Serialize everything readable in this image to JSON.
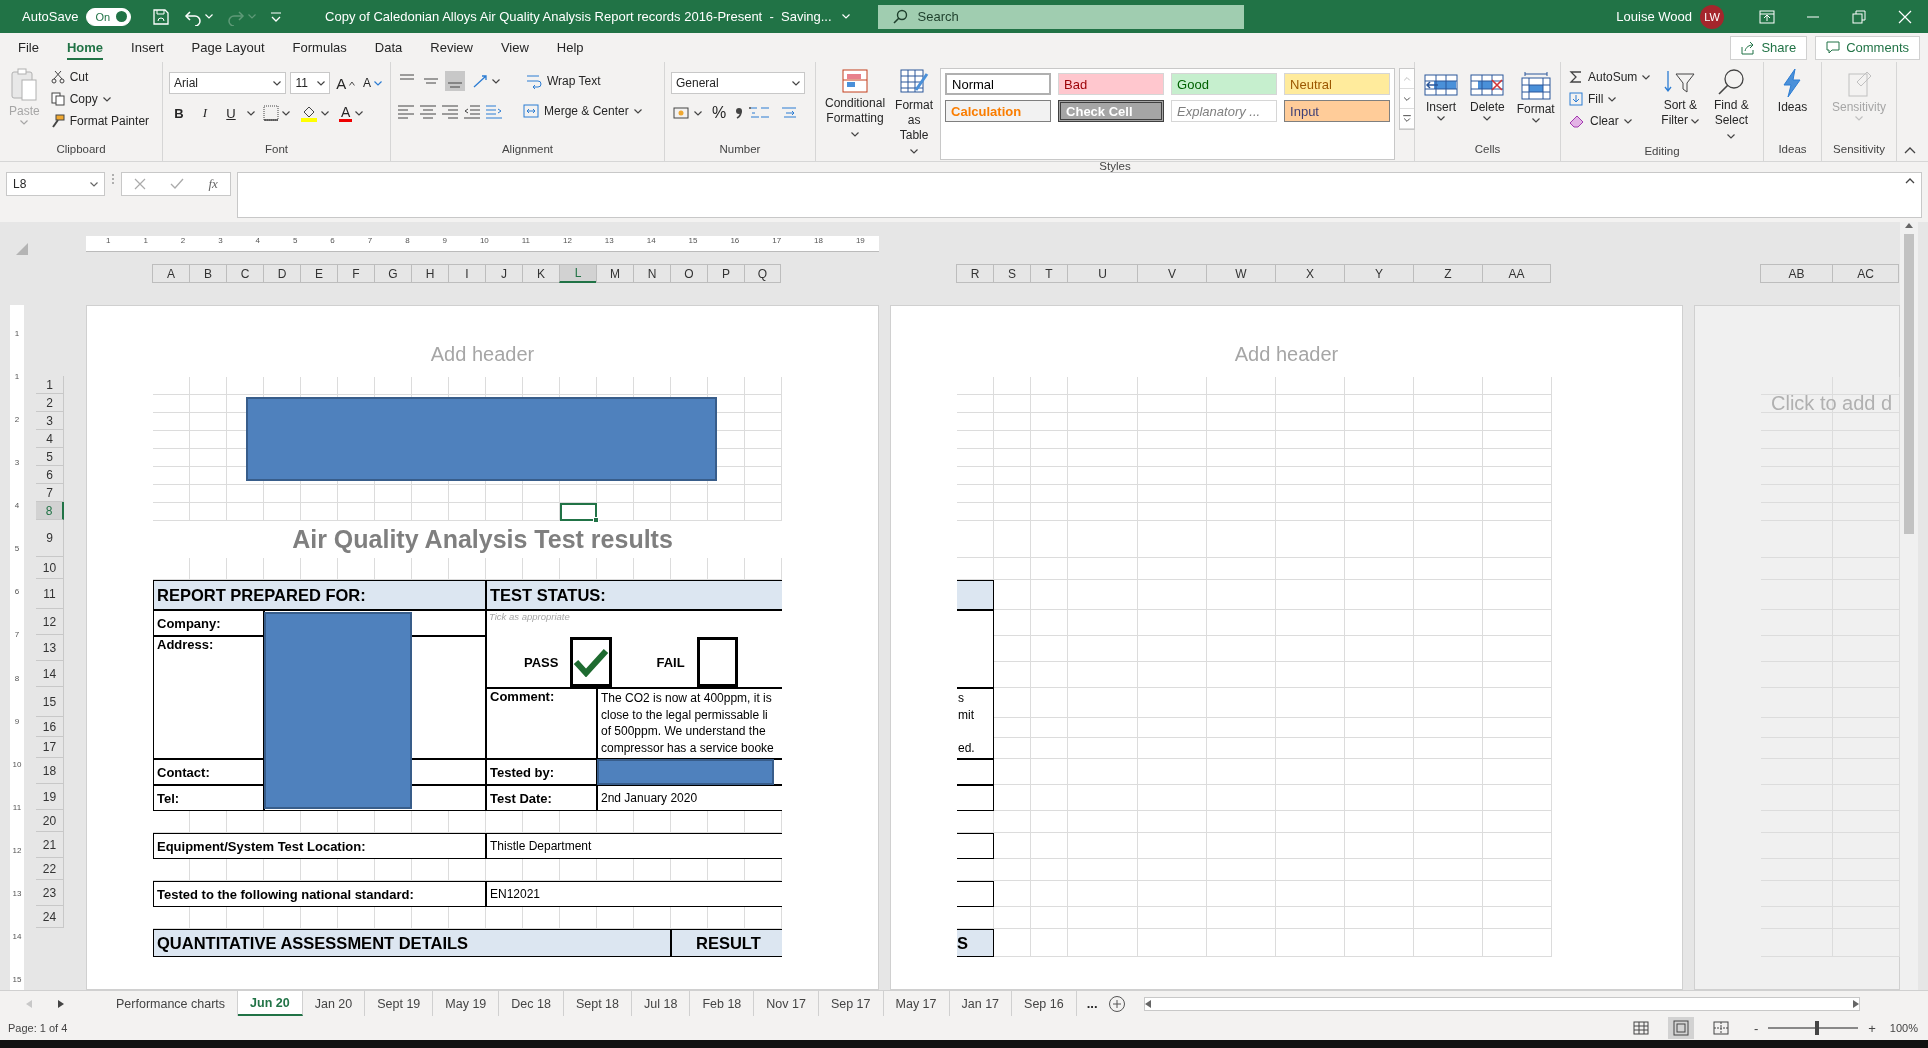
{
  "title_bar": {
    "autosave_label": "AutoSave",
    "autosave": {
      "label": "On",
      "on": true
    },
    "title": "Copy of Caledonian Alloys Air Quality Analysis Report records 2016-Present  -  Saving...",
    "search": {
      "placeholder": "Search"
    },
    "user_name": "Louise Wood",
    "user_initials": "LW"
  },
  "menu_tabs": [
    {
      "label": "File",
      "selected": false
    },
    {
      "label": "Home",
      "selected": true
    },
    {
      "label": "Insert",
      "selected": false
    },
    {
      "label": "Page Layout",
      "selected": false
    },
    {
      "label": "Formulas",
      "selected": false
    },
    {
      "label": "Data",
      "selected": false
    },
    {
      "label": "Review",
      "selected": false
    },
    {
      "label": "View",
      "selected": false
    },
    {
      "label": "Help",
      "selected": false
    }
  ],
  "share_button": "Share",
  "comments_button": "Comments",
  "ribbon": {
    "clipboard": {
      "label": "Clipboard",
      "paste": {
        "label": "Paste",
        "disabled": true
      },
      "cut": "Cut",
      "copy": "Copy",
      "format_painter": "Format Painter"
    },
    "font": {
      "label": "Font",
      "font_name": "Arial",
      "font_size": "11",
      "grow": "A",
      "shrink": "A",
      "bold": "B",
      "italic": "I",
      "underline": "U",
      "font_color": "A"
    },
    "alignment": {
      "label": "Alignment",
      "vertical": [
        {
          "kind": "top",
          "selected": false
        },
        {
          "kind": "middle",
          "selected": false
        },
        {
          "kind": "bottom",
          "selected": true
        }
      ],
      "wrap_text": "Wrap Text",
      "merge_center": "Merge & Center"
    },
    "number": {
      "label": "Number",
      "format": "General",
      "percent": "%"
    },
    "styles": {
      "label": "Styles",
      "conditional_formatting": "Conditional Formatting",
      "format_as_table": "Format as Table",
      "gallery": [
        {
          "label": "Normal",
          "kind": "normal",
          "selected": true
        },
        {
          "label": "Bad",
          "kind": "bad",
          "selected": false
        },
        {
          "label": "Good",
          "kind": "good",
          "selected": false
        },
        {
          "label": "Neutral",
          "kind": "neutral",
          "selected": false
        },
        {
          "label": "Calculation",
          "kind": "calculation",
          "selected": false
        },
        {
          "label": "Check Cell",
          "kind": "check",
          "selected": false
        },
        {
          "label": "Explanatory ...",
          "kind": "explanatory",
          "selected": false
        },
        {
          "label": "Input",
          "kind": "input",
          "selected": false
        }
      ]
    },
    "cells": {
      "label": "Cells",
      "buttons": [
        {
          "label": "Insert",
          "kind": "insert"
        },
        {
          "label": "Delete",
          "kind": "delete"
        },
        {
          "label": "Format",
          "kind": "format"
        }
      ]
    },
    "editing": {
      "label": "Editing",
      "autosum": "AutoSum",
      "fill": "Fill",
      "clear": "Clear",
      "sort_filter": "Sort & Filter",
      "find_select": "Find & Select"
    },
    "ideas": {
      "label": "Ideas",
      "button": "Ideas"
    },
    "sensitivity": {
      "label": "Sensitivity",
      "button": {
        "label": "Sensitivity",
        "disabled": true
      }
    }
  },
  "formula_bar": {
    "name_box": "L8",
    "function_label": "fx"
  },
  "ruler_marks": [
    "1",
    "1",
    "2",
    "3",
    "4",
    "5",
    "6",
    "7",
    "8",
    "9",
    "10",
    "11",
    "12",
    "13",
    "14",
    "15",
    "16",
    "17",
    "18",
    "19"
  ],
  "vertical_ruler_marks": [
    "1",
    "1",
    "2",
    "3",
    "4",
    "5",
    "6",
    "7",
    "8",
    "9",
    "10",
    "11",
    "12",
    "13",
    "14",
    "15"
  ],
  "left_page": {
    "header_placeholder": "Add header",
    "columns": [
      {
        "label": "A",
        "selected": false
      },
      {
        "label": "B",
        "selected": false
      },
      {
        "label": "C",
        "selected": false
      },
      {
        "label": "D",
        "selected": false
      },
      {
        "label": "E",
        "selected": false
      },
      {
        "label": "F",
        "selected": false
      },
      {
        "label": "G",
        "selected": false
      },
      {
        "label": "H",
        "selected": false
      },
      {
        "label": "I",
        "selected": false
      },
      {
        "label": "J",
        "selected": false
      },
      {
        "label": "K",
        "selected": false
      },
      {
        "label": "L",
        "selected": true
      },
      {
        "label": "M",
        "selected": false
      },
      {
        "label": "N",
        "selected": false
      },
      {
        "label": "O",
        "selected": false
      },
      {
        "label": "P",
        "selected": false
      },
      {
        "label": "Q",
        "selected": false
      }
    ],
    "rows": [
      {
        "label": "1",
        "selected": false
      },
      {
        "label": "2",
        "selected": false
      },
      {
        "label": "3",
        "selected": false
      },
      {
        "label": "4",
        "selected": false
      },
      {
        "label": "5",
        "selected": false
      },
      {
        "label": "6",
        "selected": false
      },
      {
        "label": "7",
        "selected": false
      },
      {
        "label": "8",
        "selected": true
      },
      {
        "label": "9",
        "selected": false
      },
      {
        "label": "10",
        "selected": false
      },
      {
        "label": "11",
        "selected": false
      },
      {
        "label": "12",
        "selected": false
      },
      {
        "label": "13",
        "selected": false
      },
      {
        "label": "14",
        "selected": false
      },
      {
        "label": "15",
        "selected": false
      },
      {
        "label": "16",
        "selected": false
      },
      {
        "label": "17",
        "selected": false
      },
      {
        "label": "18",
        "selected": false
      },
      {
        "label": "19",
        "selected": false
      },
      {
        "label": "20",
        "selected": false
      },
      {
        "label": "21",
        "selected": false
      },
      {
        "label": "22",
        "selected": false
      },
      {
        "label": "23",
        "selected": false
      },
      {
        "label": "24",
        "selected": false
      }
    ],
    "report": {
      "title": "Air Quality Analysis Test results",
      "prepared_for_heading": "REPORT PREPARED FOR:",
      "status_heading": "TEST STATUS:",
      "company_label": "Company:",
      "address_label": "Address:",
      "contact_label": "Contact:",
      "tel_label": "Tel:",
      "tick_hint": "Tick as appropriate",
      "outcomes": [
        {
          "label": "PASS",
          "checked": true
        },
        {
          "label": "FAIL",
          "checked": false
        }
      ],
      "comment_label": "Comment:",
      "comment_lines": [
        "The CO2 is now at 400ppm, it is",
        "close to the legal permissable li",
        "of 500ppm.  We understand the",
        "compressor has a service booke"
      ],
      "tested_by_label": "Tested by:",
      "test_date_label": "Test Date:",
      "test_date": "2nd January 2020",
      "location_label": "Equipment/System Test Location:",
      "location": "Thistle Department",
      "standard_label": "Tested to the following national standard:",
      "standard": "EN12021",
      "assessment_heading": "QUANTITATIVE ASSESSMENT DETAILS",
      "results_heading": "RESULT"
    }
  },
  "right_page": {
    "header_placeholder": "Add header",
    "columns": [
      "R",
      "S",
      "T",
      "U",
      "V",
      "W",
      "X",
      "Y",
      "Z",
      "AA"
    ],
    "comment_continuation": [
      "s",
      "mit",
      "ed."
    ],
    "results_continuation": "S"
  },
  "third_page": {
    "columns": [
      "AB",
      "AC"
    ],
    "placeholder": "Click to add d"
  },
  "sheet_tabs": [
    {
      "label": "Performance charts",
      "selected": false
    },
    {
      "label": "Jun 20",
      "selected": true
    },
    {
      "label": "Jan 20",
      "selected": false
    },
    {
      "label": "Sept 19",
      "selected": false
    },
    {
      "label": "May 19",
      "selected": false
    },
    {
      "label": "Dec 18",
      "selected": false
    },
    {
      "label": "Sept 18",
      "selected": false
    },
    {
      "label": "Jul 18",
      "selected": false
    },
    {
      "label": "Feb 18",
      "selected": false
    },
    {
      "label": "Nov 17",
      "selected": false
    },
    {
      "label": "Sep 17",
      "selected": false
    },
    {
      "label": "May 17",
      "selected": false
    },
    {
      "label": "Jan 17",
      "selected": false
    },
    {
      "label": "Sep 16",
      "selected": false
    }
  ],
  "more_tabs": "...",
  "status_bar": {
    "page_info": "Page: 1 of 4",
    "views": [
      {
        "kind": "normal",
        "selected": false
      },
      {
        "kind": "page_layout",
        "selected": true
      },
      {
        "kind": "page_break",
        "selected": false
      }
    ],
    "zoom": {
      "minus": "-",
      "plus": "+",
      "level": 0.52,
      "reading": "100%"
    }
  }
}
